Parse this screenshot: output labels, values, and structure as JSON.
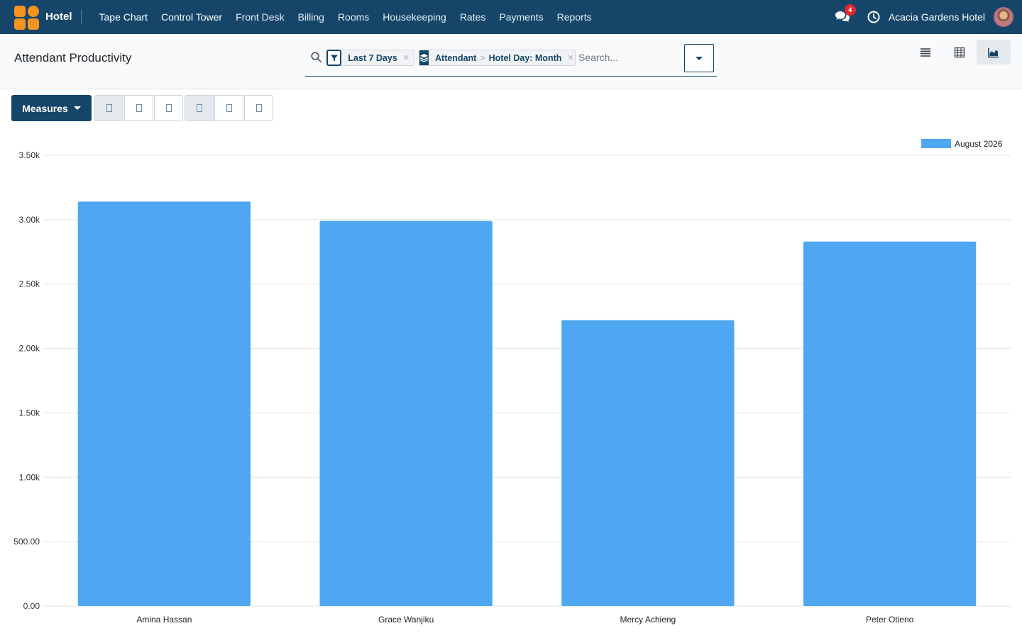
{
  "navbar": {
    "app_name": "Hotel",
    "menu": [
      {
        "label": "Tape Chart",
        "strong": true
      },
      {
        "label": "Control Tower",
        "strong": true
      },
      {
        "label": "Front Desk",
        "strong": false
      },
      {
        "label": "Billing",
        "strong": false
      },
      {
        "label": "Rooms",
        "strong": false
      },
      {
        "label": "Housekeeping",
        "strong": false
      },
      {
        "label": "Rates",
        "strong": false
      },
      {
        "label": "Payments",
        "strong": false
      },
      {
        "label": "Reports",
        "strong": false
      }
    ],
    "messages_count": "4",
    "company": "Acacia Gardens Hotel",
    "brand_color": "#15466a",
    "logo_color": "#f7941d"
  },
  "control": {
    "title": "Attendant Productivity",
    "facets": {
      "filter": "Last 7 Days",
      "group_a": "Attendant",
      "group_sep": ">",
      "group_b": "Hotel Day: Month"
    },
    "search_placeholder": "Search...",
    "views": [
      "list-icon",
      "pivot-icon",
      "graph-icon"
    ],
    "active_view": "graph-icon"
  },
  "toolbar": {
    "measures_label": "Measures"
  },
  "chart_data": {
    "type": "bar",
    "categories": [
      "Amina Hassan",
      "Grace Wanjiku",
      "Mercy Achieng",
      "Peter Otieno"
    ],
    "series": [
      {
        "name": "August 2026",
        "values": [
          3140,
          2990,
          2220,
          2830
        ],
        "color": "#4fa7f2"
      }
    ],
    "ylim": [
      0,
      3500
    ],
    "yticks": [
      0,
      500,
      1000,
      1500,
      2000,
      2500,
      3000,
      3500
    ],
    "ytick_labels": [
      "0.00",
      "500.00",
      "1.00k",
      "1.50k",
      "2.00k",
      "2.50k",
      "3.00k",
      "3.50k"
    ],
    "grid": true,
    "legend": "top-right"
  }
}
